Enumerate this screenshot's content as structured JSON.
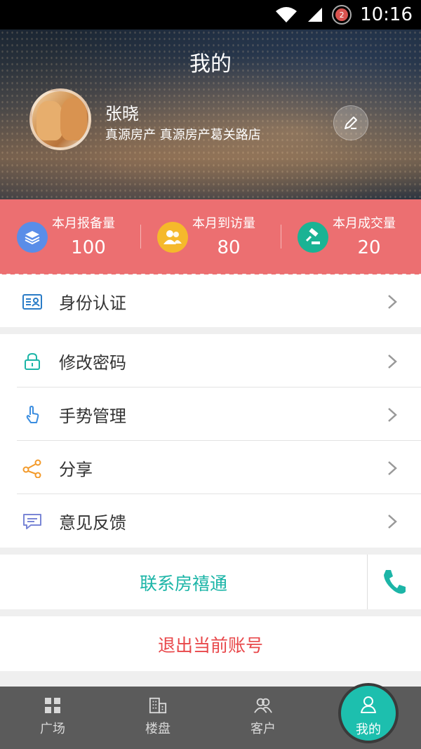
{
  "statusbar": {
    "time": "10:16",
    "notification_count": "2"
  },
  "header": {
    "title": "我的",
    "user_name": "张晓",
    "user_org": "真源房产 真源房产葛关路店"
  },
  "stats": [
    {
      "label": "本月报备量",
      "value": "100",
      "color": "#5a8de8"
    },
    {
      "label": "本月到访量",
      "value": "80",
      "color": "#f5b92b"
    },
    {
      "label": "本月成交量",
      "value": "20",
      "color": "#1ab394"
    }
  ],
  "menu_group1": [
    {
      "label": "身份认证",
      "icon": "id-card-icon"
    }
  ],
  "menu_group2": [
    {
      "label": "修改密码",
      "icon": "lock-icon"
    },
    {
      "label": "手势管理",
      "icon": "gesture-icon"
    },
    {
      "label": "分享",
      "icon": "share-icon"
    },
    {
      "label": "意见反馈",
      "icon": "feedback-icon"
    }
  ],
  "contact": {
    "label": "联系房禧通"
  },
  "logout": {
    "label": "退出当前账号"
  },
  "tabbar": [
    {
      "label": "广场",
      "icon": "grid-icon"
    },
    {
      "label": "楼盘",
      "icon": "building-icon"
    },
    {
      "label": "客户",
      "icon": "customers-icon"
    },
    {
      "label": "我的",
      "icon": "person-icon"
    }
  ]
}
